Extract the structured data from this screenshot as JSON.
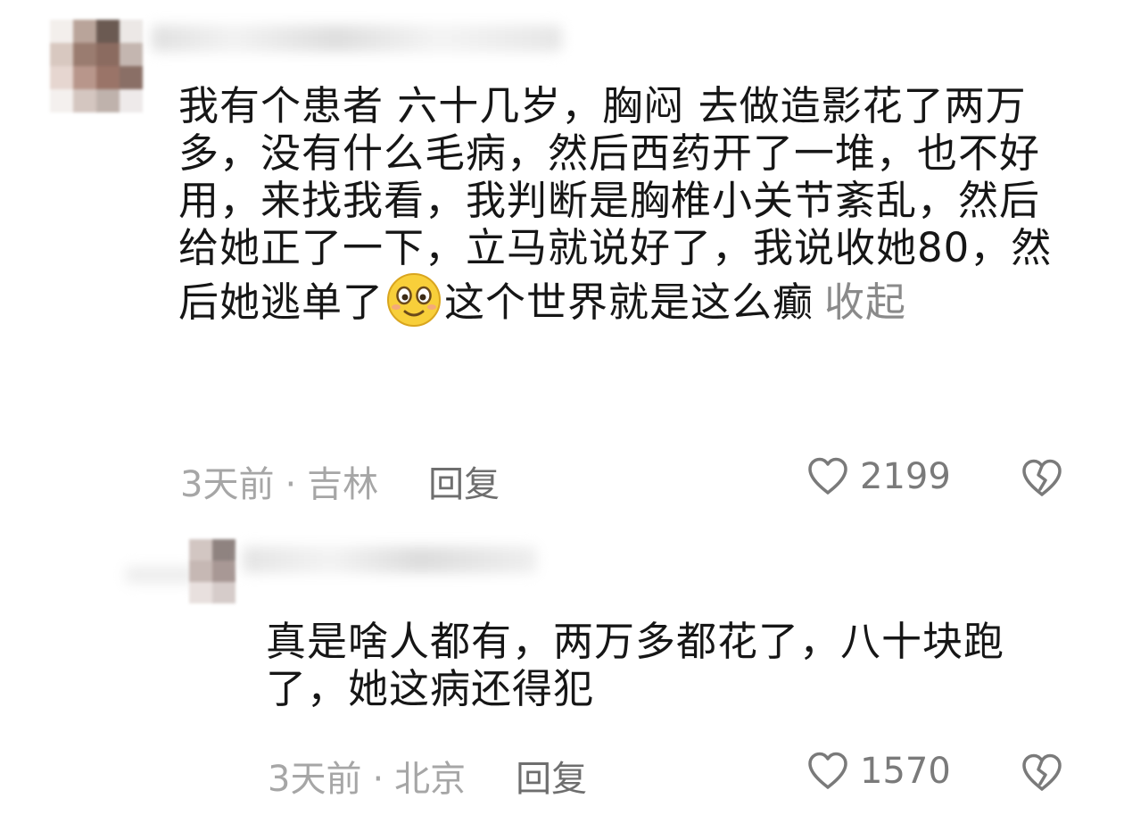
{
  "comments": [
    {
      "text_part1": "我有个患者 六十几岁，胸闷 去做造影花了两万多，没有什么毛病，然后西药开了一堆，也不好用，来找我看，我判断是胸椎小关节紊乱，然后给她正了一下，立马就说好了，我说收她80，然后她逃单了",
      "emoji": "smiley-blush-emoji",
      "text_part2": "这个世界就是这么癫",
      "collapse_label": "收起",
      "time": "3天前",
      "location": "吉林",
      "reply_label": "回复",
      "likes": "2199",
      "like_icon": "heart-outline-icon",
      "dislike_icon": "broken-heart-icon"
    },
    {
      "text": "真是啥人都有，两万多都花了，八十块跑了，她这病还得犯",
      "time": "3天前",
      "location": "北京",
      "reply_label": "回复",
      "likes": "1570",
      "like_icon": "heart-outline-icon",
      "dislike_icon": "broken-heart-icon"
    }
  ],
  "separator": "·",
  "colors": {
    "text": "#161616",
    "meta": "#a6a6a6",
    "icon": "#7a7a7a",
    "emoji_face": "#f8cf3a"
  }
}
